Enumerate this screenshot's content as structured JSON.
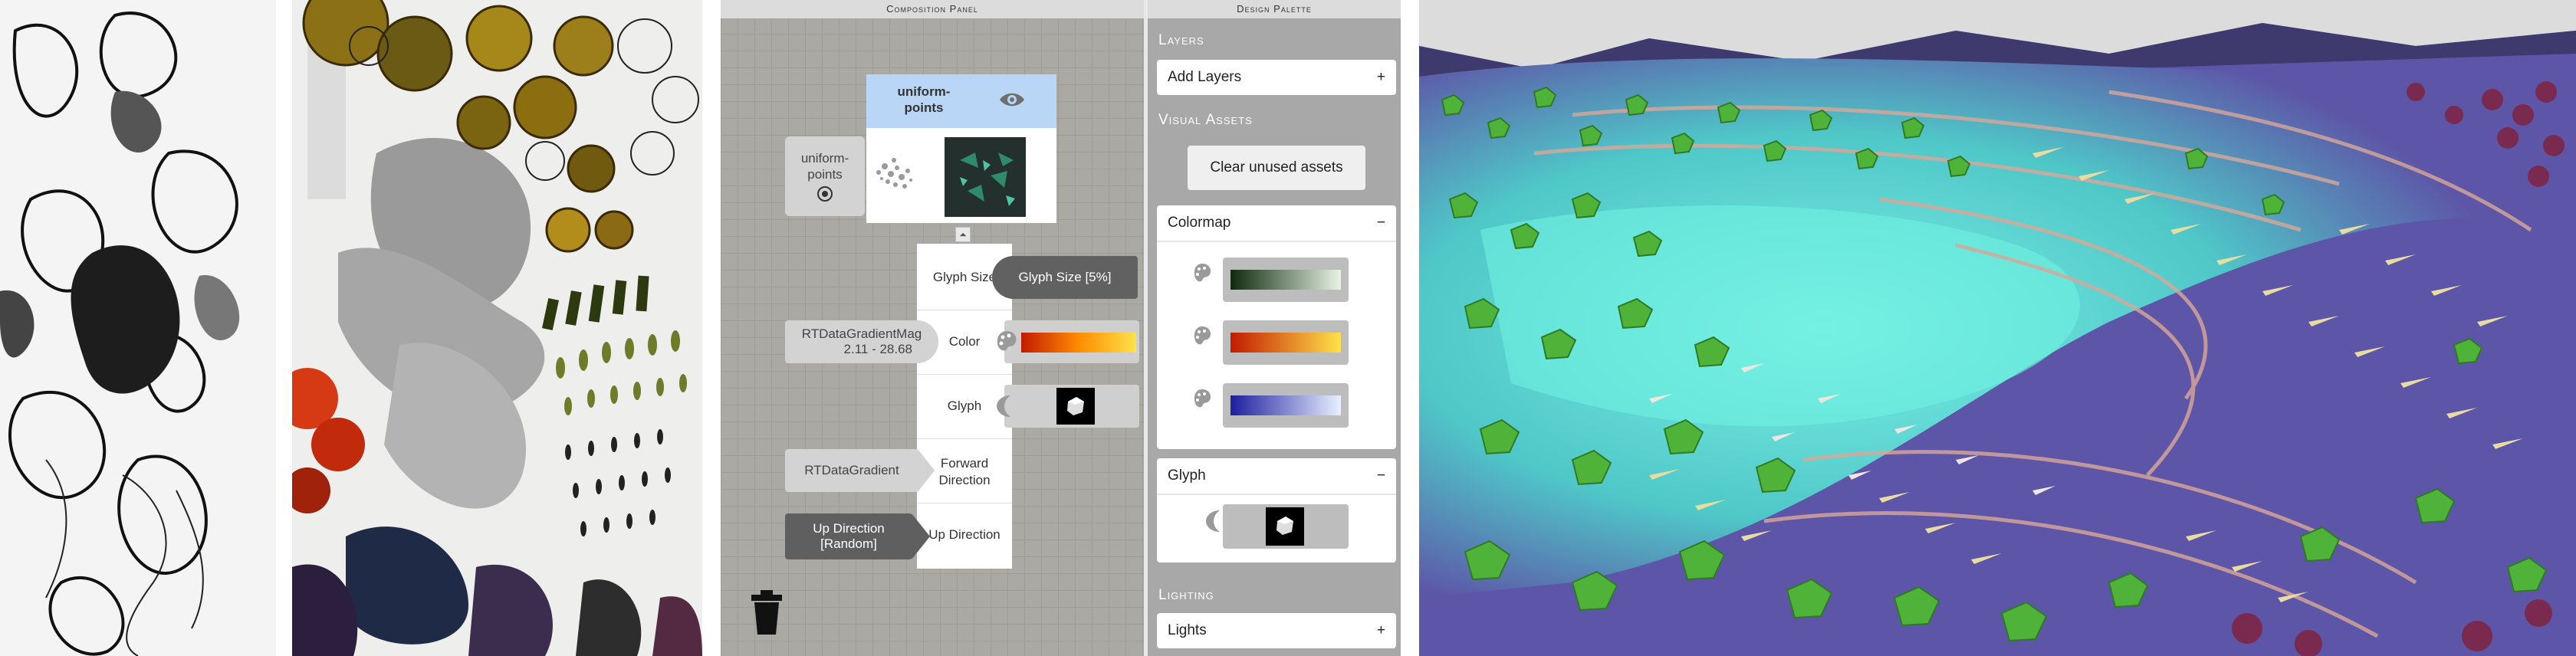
{
  "composition_panel": {
    "title": "Composition Panel",
    "uniform_points_header": "uniform-\npoints",
    "uniform_points_source": "uniform-\npoints",
    "glyph_size_label": "Glyph Size",
    "glyph_size_value": "Glyph Size [5%]",
    "gradient_mag_name": "RTDataGradientMag",
    "gradient_mag_range": "2.11 - 28.68",
    "color_label": "Color",
    "glyph_label": "Glyph",
    "gradient_name": "RTDataGradient",
    "forward_direction_label": "Forward\nDirection",
    "up_direction_value": "Up Direction\n[Random]",
    "up_direction_label": "Up Direction",
    "expand_glyph": "⏶",
    "trash_icon": "trash-icon"
  },
  "design_palette": {
    "title": "Design Palette",
    "layers_title": "Layers",
    "add_layers_label": "Add Layers",
    "add_icon": "+",
    "visual_assets_title": "Visual Assets",
    "clear_button": "Clear unused assets",
    "colormap_title": "Colormap",
    "collapse_icon": "−",
    "colormaps": [
      {
        "name": "green",
        "from": "#0f2a0e",
        "to": "#e8f3e5"
      },
      {
        "name": "orange",
        "from": "#c21b00",
        "to": "#ffe34a"
      },
      {
        "name": "blue",
        "from": "#1d1f9e",
        "to": "#e8f0ff"
      }
    ],
    "glyph_title": "Glyph",
    "lighting_title": "Lighting",
    "lights_label": "Lights"
  },
  "colors": {
    "selected_node": "#b9d6f7",
    "panel_bg": "#aaa9a3",
    "viewport_water": "#67e0d4"
  }
}
